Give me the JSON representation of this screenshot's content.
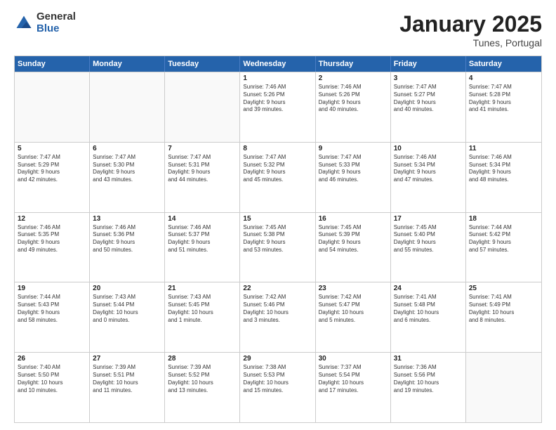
{
  "logo": {
    "general": "General",
    "blue": "Blue"
  },
  "header": {
    "month": "January 2025",
    "location": "Tunes, Portugal"
  },
  "weekdays": [
    "Sunday",
    "Monday",
    "Tuesday",
    "Wednesday",
    "Thursday",
    "Friday",
    "Saturday"
  ],
  "rows": [
    [
      {
        "day": "",
        "info": ""
      },
      {
        "day": "",
        "info": ""
      },
      {
        "day": "",
        "info": ""
      },
      {
        "day": "1",
        "info": "Sunrise: 7:46 AM\nSunset: 5:26 PM\nDaylight: 9 hours\nand 39 minutes."
      },
      {
        "day": "2",
        "info": "Sunrise: 7:46 AM\nSunset: 5:26 PM\nDaylight: 9 hours\nand 40 minutes."
      },
      {
        "day": "3",
        "info": "Sunrise: 7:47 AM\nSunset: 5:27 PM\nDaylight: 9 hours\nand 40 minutes."
      },
      {
        "day": "4",
        "info": "Sunrise: 7:47 AM\nSunset: 5:28 PM\nDaylight: 9 hours\nand 41 minutes."
      }
    ],
    [
      {
        "day": "5",
        "info": "Sunrise: 7:47 AM\nSunset: 5:29 PM\nDaylight: 9 hours\nand 42 minutes."
      },
      {
        "day": "6",
        "info": "Sunrise: 7:47 AM\nSunset: 5:30 PM\nDaylight: 9 hours\nand 43 minutes."
      },
      {
        "day": "7",
        "info": "Sunrise: 7:47 AM\nSunset: 5:31 PM\nDaylight: 9 hours\nand 44 minutes."
      },
      {
        "day": "8",
        "info": "Sunrise: 7:47 AM\nSunset: 5:32 PM\nDaylight: 9 hours\nand 45 minutes."
      },
      {
        "day": "9",
        "info": "Sunrise: 7:47 AM\nSunset: 5:33 PM\nDaylight: 9 hours\nand 46 minutes."
      },
      {
        "day": "10",
        "info": "Sunrise: 7:46 AM\nSunset: 5:34 PM\nDaylight: 9 hours\nand 47 minutes."
      },
      {
        "day": "11",
        "info": "Sunrise: 7:46 AM\nSunset: 5:34 PM\nDaylight: 9 hours\nand 48 minutes."
      }
    ],
    [
      {
        "day": "12",
        "info": "Sunrise: 7:46 AM\nSunset: 5:35 PM\nDaylight: 9 hours\nand 49 minutes."
      },
      {
        "day": "13",
        "info": "Sunrise: 7:46 AM\nSunset: 5:36 PM\nDaylight: 9 hours\nand 50 minutes."
      },
      {
        "day": "14",
        "info": "Sunrise: 7:46 AM\nSunset: 5:37 PM\nDaylight: 9 hours\nand 51 minutes."
      },
      {
        "day": "15",
        "info": "Sunrise: 7:45 AM\nSunset: 5:38 PM\nDaylight: 9 hours\nand 53 minutes."
      },
      {
        "day": "16",
        "info": "Sunrise: 7:45 AM\nSunset: 5:39 PM\nDaylight: 9 hours\nand 54 minutes."
      },
      {
        "day": "17",
        "info": "Sunrise: 7:45 AM\nSunset: 5:40 PM\nDaylight: 9 hours\nand 55 minutes."
      },
      {
        "day": "18",
        "info": "Sunrise: 7:44 AM\nSunset: 5:42 PM\nDaylight: 9 hours\nand 57 minutes."
      }
    ],
    [
      {
        "day": "19",
        "info": "Sunrise: 7:44 AM\nSunset: 5:43 PM\nDaylight: 9 hours\nand 58 minutes."
      },
      {
        "day": "20",
        "info": "Sunrise: 7:43 AM\nSunset: 5:44 PM\nDaylight: 10 hours\nand 0 minutes."
      },
      {
        "day": "21",
        "info": "Sunrise: 7:43 AM\nSunset: 5:45 PM\nDaylight: 10 hours\nand 1 minute."
      },
      {
        "day": "22",
        "info": "Sunrise: 7:42 AM\nSunset: 5:46 PM\nDaylight: 10 hours\nand 3 minutes."
      },
      {
        "day": "23",
        "info": "Sunrise: 7:42 AM\nSunset: 5:47 PM\nDaylight: 10 hours\nand 5 minutes."
      },
      {
        "day": "24",
        "info": "Sunrise: 7:41 AM\nSunset: 5:48 PM\nDaylight: 10 hours\nand 6 minutes."
      },
      {
        "day": "25",
        "info": "Sunrise: 7:41 AM\nSunset: 5:49 PM\nDaylight: 10 hours\nand 8 minutes."
      }
    ],
    [
      {
        "day": "26",
        "info": "Sunrise: 7:40 AM\nSunset: 5:50 PM\nDaylight: 10 hours\nand 10 minutes."
      },
      {
        "day": "27",
        "info": "Sunrise: 7:39 AM\nSunset: 5:51 PM\nDaylight: 10 hours\nand 11 minutes."
      },
      {
        "day": "28",
        "info": "Sunrise: 7:39 AM\nSunset: 5:52 PM\nDaylight: 10 hours\nand 13 minutes."
      },
      {
        "day": "29",
        "info": "Sunrise: 7:38 AM\nSunset: 5:53 PM\nDaylight: 10 hours\nand 15 minutes."
      },
      {
        "day": "30",
        "info": "Sunrise: 7:37 AM\nSunset: 5:54 PM\nDaylight: 10 hours\nand 17 minutes."
      },
      {
        "day": "31",
        "info": "Sunrise: 7:36 AM\nSunset: 5:56 PM\nDaylight: 10 hours\nand 19 minutes."
      },
      {
        "day": "",
        "info": ""
      }
    ]
  ]
}
